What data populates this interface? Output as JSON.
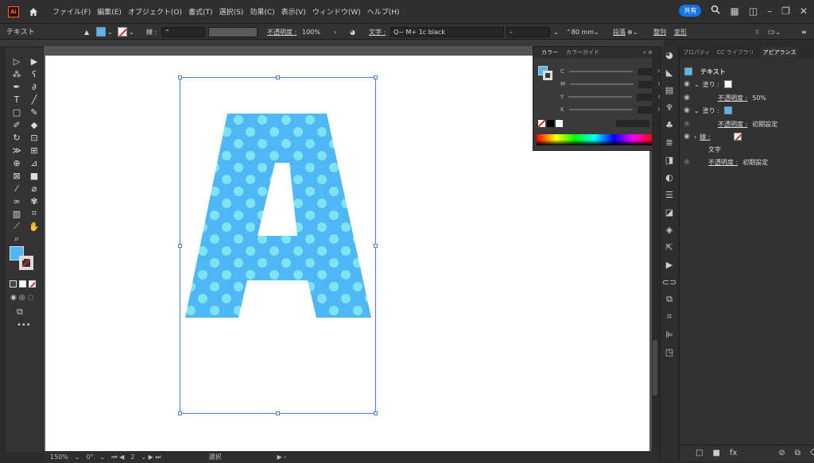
{
  "menubar": {
    "app_logo": "Ai",
    "items": [
      "ファイル(F)",
      "編集(E)",
      "オブジェクト(O)",
      "書式(T)",
      "選択(S)",
      "効果(C)",
      "表示(V)",
      "ウィンドウ(W)",
      "ヘルプ(H)"
    ],
    "share": "共有"
  },
  "control": {
    "mode_label": "テキスト",
    "stroke_label": "線 :",
    "opacity_label": "不透明度 :",
    "opacity_value": "100%",
    "char_label": "文字 :",
    "font_value": "Q~ M+ 1c black",
    "size_value": "80 mm",
    "paragraph_label": "段落",
    "arrange_label": "整列",
    "transform_label": "変形"
  },
  "color_panel": {
    "tabs": [
      "カラー",
      "カラーガイド"
    ],
    "channels": [
      "C",
      "M",
      "Y",
      "K"
    ],
    "unit": "%"
  },
  "right_panel": {
    "tabs": [
      "プロパティ",
      "CC ライブラリ",
      "アピアランス"
    ],
    "object_label": "テキスト",
    "rows": [
      {
        "label": "塗り :",
        "swatch": "#ffffff"
      },
      {
        "label": "不透明度 :",
        "value": "50%"
      },
      {
        "label": "塗り :",
        "swatch": "#4db8f5"
      },
      {
        "label": "不透明度 :",
        "value": "初期設定"
      },
      {
        "label": "線 :",
        "swatch": "none"
      },
      {
        "label": "文字"
      },
      {
        "label": "不透明度 :",
        "value": "初期設定"
      }
    ]
  },
  "status": {
    "zoom": "150%",
    "rotation": "0°",
    "artboard_num": "2",
    "mode": "選択"
  },
  "artwork": {
    "letter": "A",
    "fill_color": "#4db8f5",
    "dot_color": "#7fe3f0"
  }
}
